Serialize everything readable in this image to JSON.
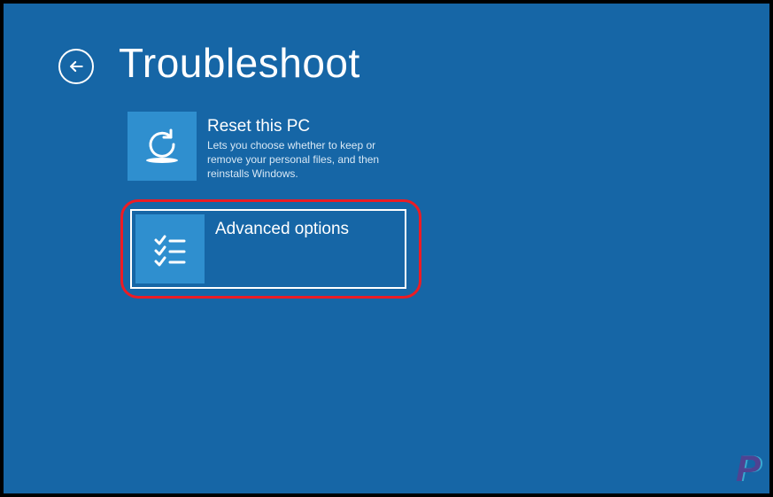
{
  "page": {
    "title": "Troubleshoot"
  },
  "options": [
    {
      "title": "Reset this PC",
      "description": "Lets you choose whether to keep or remove your personal files, and then reinstalls Windows.",
      "icon": "reset-icon"
    },
    {
      "title": "Advanced options",
      "description": "",
      "icon": "checklist-icon"
    }
  ],
  "watermark": "P"
}
